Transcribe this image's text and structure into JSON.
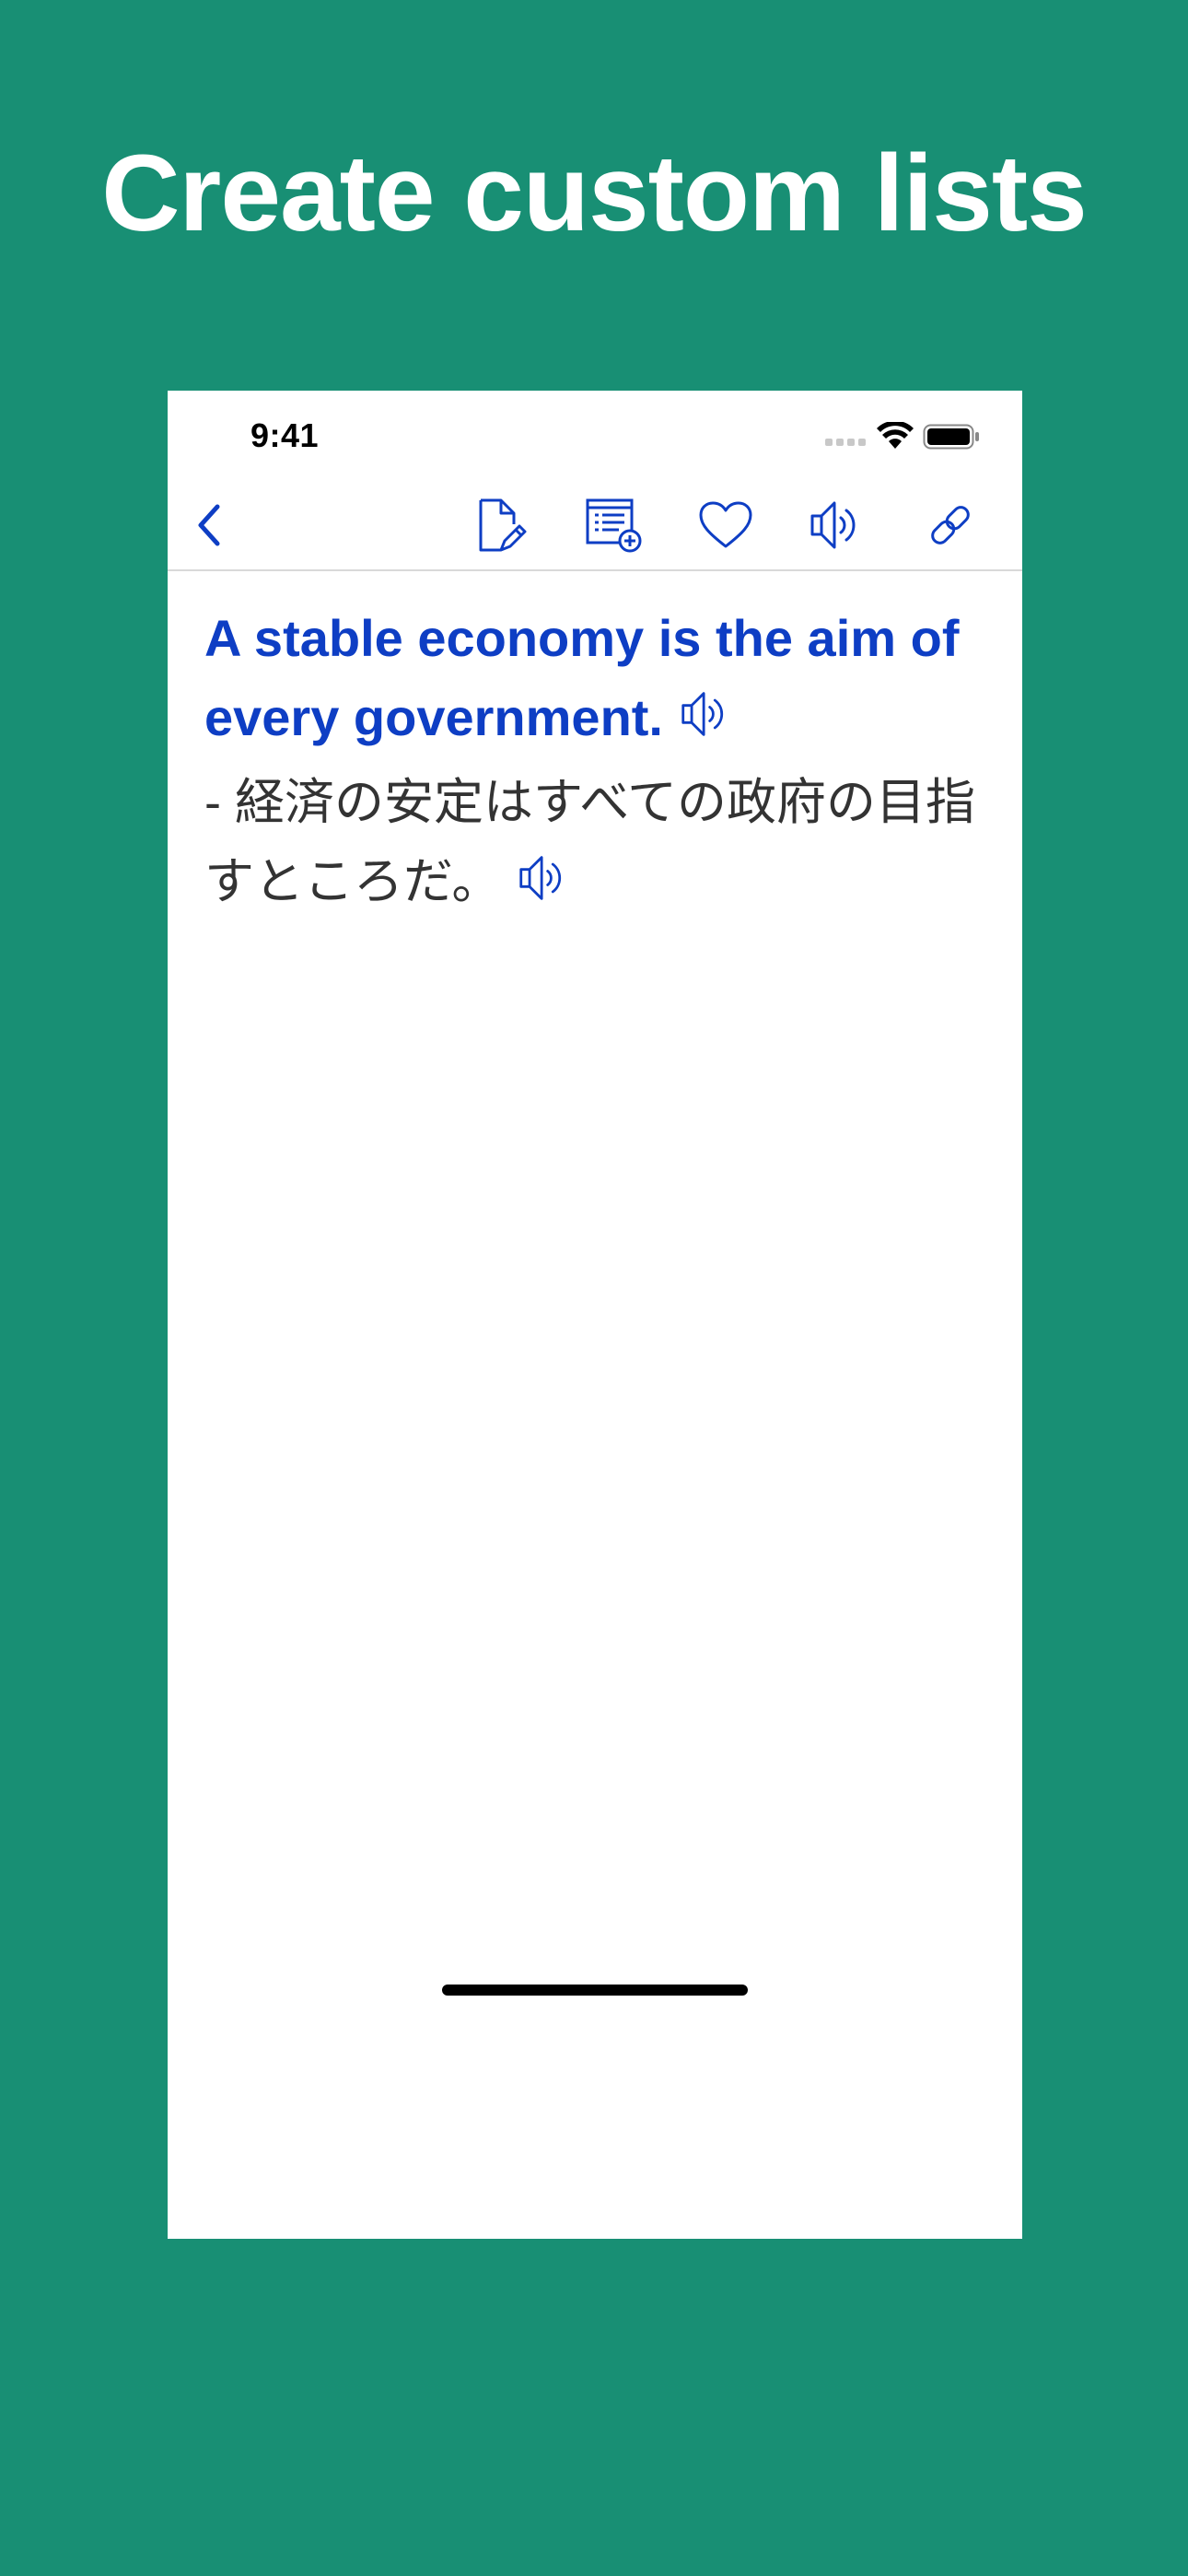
{
  "headline": "Create custom lists",
  "status_bar": {
    "time": "9:41"
  },
  "toolbar": {
    "icons": [
      "chevron-left-icon",
      "edit-document-icon",
      "add-to-list-icon",
      "heart-icon",
      "speaker-icon",
      "link-icon"
    ]
  },
  "content": {
    "sentence": "A stable economy is the aim of every government.",
    "translation": "- 経済の安定はすべての政府の目指すところだ。"
  },
  "colors": {
    "background": "#188f74",
    "accent": "#0e3ec4",
    "translation_text": "#333333"
  }
}
